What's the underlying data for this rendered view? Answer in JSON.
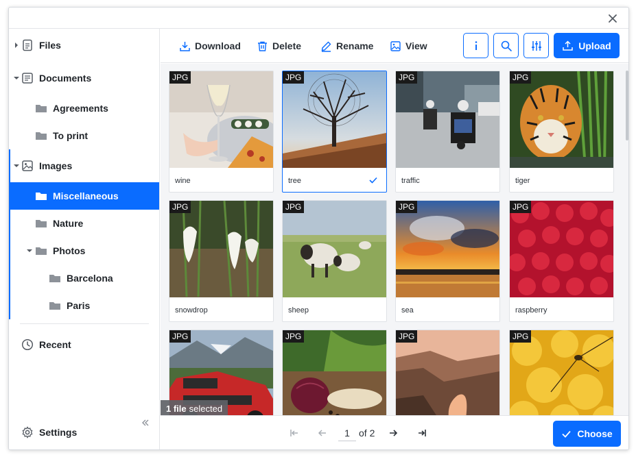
{
  "window": {
    "close_icon": "close-icon"
  },
  "sidebar": {
    "items": [
      {
        "label": "Files",
        "icon": "file-icon"
      },
      {
        "label": "Documents",
        "icon": "document-icon"
      },
      {
        "label": "Agreements",
        "icon": "folder-icon"
      },
      {
        "label": "To print",
        "icon": "folder-icon"
      },
      {
        "label": "Images",
        "icon": "image-icon"
      },
      {
        "label": "Miscellaneous",
        "icon": "folder-icon"
      },
      {
        "label": "Nature",
        "icon": "folder-icon"
      },
      {
        "label": "Photos",
        "icon": "folder-icon"
      },
      {
        "label": "Barcelona",
        "icon": "folder-icon"
      },
      {
        "label": "Paris",
        "icon": "folder-icon"
      },
      {
        "label": "Recent",
        "icon": "clock-icon"
      },
      {
        "label": "Settings",
        "icon": "gear-icon"
      }
    ],
    "active": "Miscellaneous"
  },
  "toolbar": {
    "download": "Download",
    "delete": "Delete",
    "rename": "Rename",
    "view": "View",
    "info_icon": "info-icon",
    "search_icon": "search-icon",
    "filter_icon": "sliders-icon",
    "upload": "Upload"
  },
  "files": [
    {
      "name": "wine",
      "type": "JPG",
      "selected": false
    },
    {
      "name": "tree",
      "type": "JPG",
      "selected": true
    },
    {
      "name": "traffic",
      "type": "JPG",
      "selected": false
    },
    {
      "name": "tiger",
      "type": "JPG",
      "selected": false
    },
    {
      "name": "snowdrop",
      "type": "JPG",
      "selected": false
    },
    {
      "name": "sheep",
      "type": "JPG",
      "selected": false
    },
    {
      "name": "sea",
      "type": "JPG",
      "selected": false
    },
    {
      "name": "raspberry",
      "type": "JPG",
      "selected": false
    },
    {
      "name": "",
      "type": "JPG",
      "selected": false
    },
    {
      "name": "",
      "type": "JPG",
      "selected": false
    },
    {
      "name": "",
      "type": "JPG",
      "selected": false
    },
    {
      "name": "",
      "type": "JPG",
      "selected": false
    }
  ],
  "selection": {
    "count": "1 file",
    "suffix": "selected"
  },
  "pagination": {
    "current": "1",
    "of_label": "of 2"
  },
  "footer": {
    "choose": "Choose"
  },
  "colors": {
    "accent": "#0a6cff"
  }
}
